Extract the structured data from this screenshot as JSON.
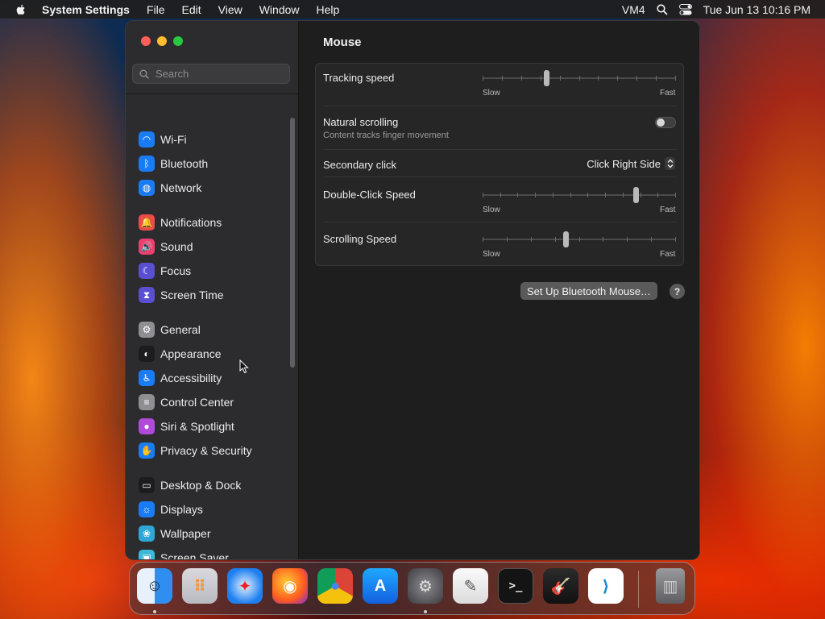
{
  "menubar": {
    "app_name": "System Settings",
    "menus": [
      "File",
      "Edit",
      "View",
      "Window",
      "Help"
    ],
    "status_vm": "VM4",
    "clock": "Tue Jun 13  10:16 PM"
  },
  "sidebar": {
    "search_placeholder": "Search",
    "items": [
      {
        "label": "Wi-Fi",
        "icon": "wifi-icon",
        "color": "#1a7cf5"
      },
      {
        "label": "Bluetooth",
        "icon": "bluetooth-icon",
        "color": "#1a7cf5"
      },
      {
        "label": "Network",
        "icon": "globe-icon",
        "color": "#1a7cf5"
      },
      {
        "label": "Notifications",
        "icon": "bell-icon",
        "color": "#eb4c49"
      },
      {
        "label": "Sound",
        "icon": "speaker-icon",
        "color": "#eb3f6e"
      },
      {
        "label": "Focus",
        "icon": "moon-icon",
        "color": "#5a4fd1"
      },
      {
        "label": "Screen Time",
        "icon": "hourglass-icon",
        "color": "#5a4fd1"
      },
      {
        "label": "General",
        "icon": "gear-icon",
        "color": "#8e8e93"
      },
      {
        "label": "Appearance",
        "icon": "appearance-icon",
        "color": "#1c1c1e"
      },
      {
        "label": "Accessibility",
        "icon": "accessibility-icon",
        "color": "#1a7cf5"
      },
      {
        "label": "Control Center",
        "icon": "toggles-icon",
        "color": "#8e8e93"
      },
      {
        "label": "Siri & Spotlight",
        "icon": "siri-icon",
        "color": "#b04ad8"
      },
      {
        "label": "Privacy & Security",
        "icon": "hand-icon",
        "color": "#1a7cf5"
      },
      {
        "label": "Desktop & Dock",
        "icon": "dock-icon",
        "color": "#1c1c1e"
      },
      {
        "label": "Displays",
        "icon": "sun-icon",
        "color": "#1a7cf5"
      },
      {
        "label": "Wallpaper",
        "icon": "flower-icon",
        "color": "#2ea7d8"
      },
      {
        "label": "Screen Saver",
        "icon": "screensaver-icon",
        "color": "#3cb8d8"
      }
    ]
  },
  "main": {
    "title": "Mouse",
    "tracking": {
      "label": "Tracking speed",
      "min": "Slow",
      "max": "Fast",
      "value": 0.33
    },
    "natural_scrolling": {
      "label": "Natural scrolling",
      "sub": "Content tracks finger movement",
      "on": false
    },
    "secondary_click": {
      "label": "Secondary click",
      "value": "Click Right Side"
    },
    "double_click": {
      "label": "Double-Click Speed",
      "min": "Slow",
      "max": "Fast",
      "value": 0.79
    },
    "scrolling": {
      "label": "Scrolling Speed",
      "min": "Slow",
      "max": "Fast",
      "value": 0.43
    },
    "bt_button": "Set Up Bluetooth Mouse…",
    "help_button": "?"
  },
  "dock": {
    "apps": [
      "finder-icon",
      "launchpad-icon",
      "safari-icon",
      "firefox-icon",
      "chrome-icon",
      "app-store-icon",
      "system-settings-icon",
      "textedit-icon",
      "terminal-icon",
      "garageband-icon",
      "vscode-icon",
      "trash-icon"
    ]
  }
}
